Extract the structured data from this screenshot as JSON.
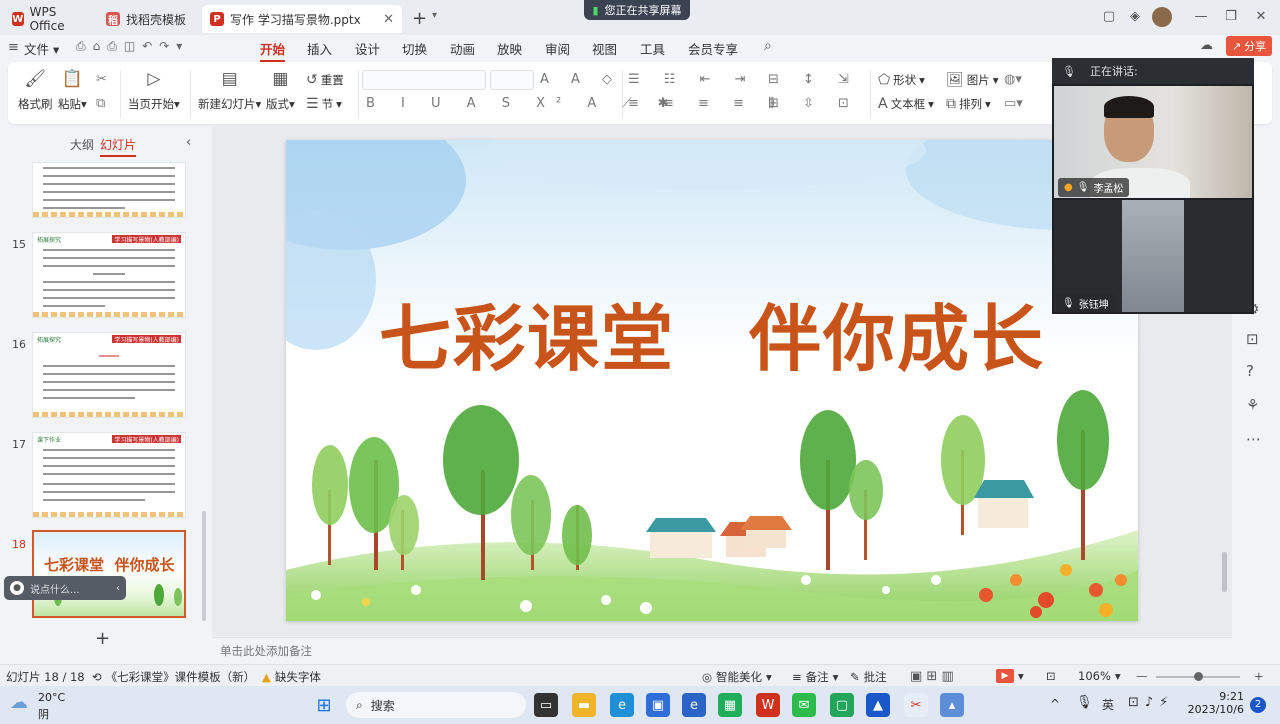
{
  "tabs": {
    "app": "WPS Office",
    "template": "找稻壳模板",
    "document": "写作 学习描写景物.pptx",
    "new": "+"
  },
  "sharing_banner": "您正在共享屏幕",
  "menu": {
    "file": "文件",
    "items": [
      "开始",
      "插入",
      "设计",
      "切换",
      "动画",
      "放映",
      "审阅",
      "视图",
      "工具",
      "会员专享"
    ],
    "share": "分享"
  },
  "ribbon": {
    "format_painter": "格式刷",
    "paste": "粘贴",
    "play_from_current": "当页开始",
    "new_slide": "新建幻灯片",
    "layout": "版式",
    "reset": "重置",
    "section": "节",
    "shape": "形状",
    "picture": "图片",
    "textbox": "文本框",
    "arrange": "排列"
  },
  "left_panel": {
    "tab_outline": "大纲",
    "tab_slides": "幻灯片",
    "thumb_header_left": "拓展探究",
    "thumb_header_right": "学习描写景物(人教部编)",
    "thumb_header_left_17": "课下作业",
    "slides": [
      {
        "num": "15"
      },
      {
        "num": "16"
      },
      {
        "num": "17"
      },
      {
        "num": "18",
        "title_a": "七彩课堂",
        "title_b": "伴你成长"
      }
    ],
    "voice_input": "说点什么...",
    "add": "+"
  },
  "slide": {
    "title": "七彩课堂　伴你成长"
  },
  "notes_placeholder": "单击此处添加备注",
  "meeting": {
    "speaking_label": "正在讲话:",
    "participant1": "李孟松",
    "participant2": "张钰坤"
  },
  "status_bar": {
    "slide_counter": "幻灯片 18 / 18",
    "template_name": "《七彩课堂》课件模板（新）",
    "missing_font": "缺失字体",
    "smart_beautify": "智能美化",
    "notes": "备注",
    "comments": "批注",
    "zoom": "106%"
  },
  "taskbar": {
    "weather_temp": "20°C",
    "weather_desc": "阴",
    "search": "搜索",
    "ime": "英",
    "time": "9:21",
    "date": "2023/10/6",
    "notification_count": "2"
  },
  "colors": {
    "accent": "#d0311f",
    "title_orange": "#c9541a",
    "share_button": "#e8553c"
  }
}
